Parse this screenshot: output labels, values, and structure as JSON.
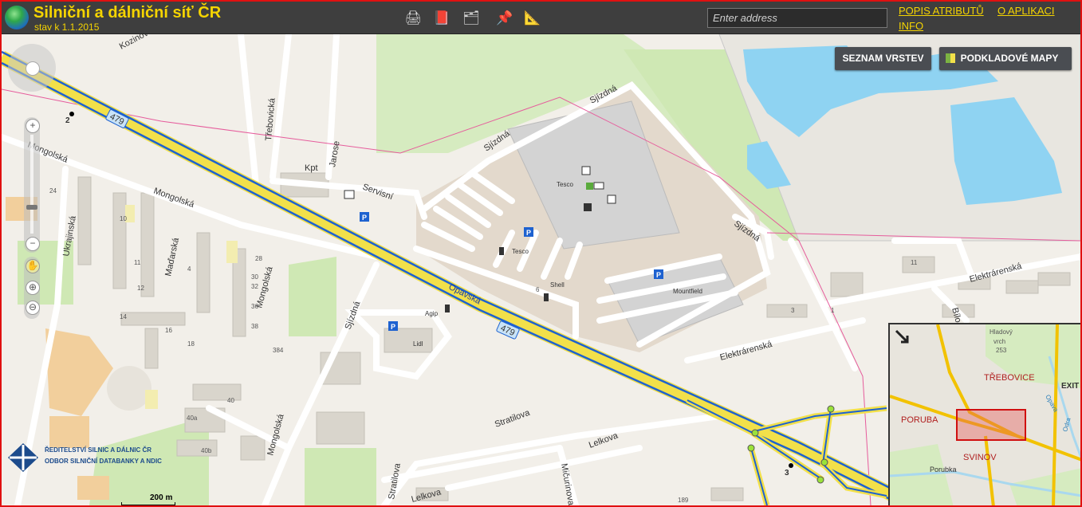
{
  "header": {
    "title": "Silniční a dálniční síť ČR",
    "subtitle": "stav k 1.1.2015",
    "tools": [
      {
        "name": "print-icon",
        "glyph": "🖨"
      },
      {
        "name": "book-icon",
        "glyph": "📕"
      },
      {
        "name": "layers-icon",
        "glyph": "🗂"
      },
      {
        "name": "pin-icon",
        "glyph": "📌"
      },
      {
        "name": "measure-icon",
        "glyph": "📐"
      }
    ],
    "search_placeholder": "Enter address",
    "links": {
      "attributes": "POPIS ATRIBUTŮ",
      "about": "O APLIKACI",
      "info": "INFO"
    }
  },
  "buttons": {
    "layers": "SEZNAM VRSTEV",
    "basemaps": "PODKLADOVÉ MAPY"
  },
  "map": {
    "road_labels": {
      "kozinova": "Kozinova",
      "trebovicka": "Třebovická",
      "jarose": "Jarose",
      "kpt": "Kpt",
      "servisni": "Servisní",
      "sjizdna1": "Sjízdná",
      "sjizdna2": "Sjízdná",
      "sjizdna3": "Sjízdná",
      "sjizdna4": "Sjízdná",
      "mongolska1": "Mongolská",
      "mongolska2": "Mongolská",
      "mongolska3": "Mongolská",
      "mongolska4": "Mongolská",
      "ukrajinska": "Ukrajinská",
      "madarska": "Maďarská",
      "opavska": "Opavská",
      "elektrarenska1": "Elektrárenská",
      "elektrarenska2": "Elektrárenská",
      "stratilova1": "Stratilova",
      "stratilova2": "Stratilova",
      "lelkova1": "Lelkova",
      "lelkova2": "Lelkova",
      "micurinova": "Mičurinova",
      "bilovecka": "Bílo"
    },
    "route_shields": [
      "479",
      "479"
    ],
    "poi_labels": {
      "tesco1": "Tesco",
      "tesco2": "Tesco",
      "shell": "Shell",
      "mountfield": "Mountfield",
      "agip": "Agip",
      "lidl": "Lidl"
    },
    "km_markers": [
      "2",
      "3"
    ],
    "house_numbers": [
      "10",
      "12",
      "16",
      "18",
      "24",
      "28",
      "30",
      "32",
      "36",
      "38",
      "40",
      "14",
      "4",
      "11",
      "384",
      "40a",
      "40b",
      "6",
      "3",
      "1",
      "11",
      "189"
    ]
  },
  "overview": {
    "labels": {
      "trebovice": "TŘEBOVICE",
      "poruba": "PORUBA",
      "porubka": "Porubka",
      "svinov": "SVINOV",
      "exit": "EXIT",
      "hladovy": "Hladový",
      "vrch": "vrch",
      "elev": "253",
      "opava": "Opava",
      "odra": "Odra"
    }
  },
  "scale": {
    "label": "200 m"
  },
  "logo": {
    "line1": "ŘEDITELSTVÍ SILNIC A DÁLNIC ČR",
    "line2": "ODBOR SILNIČNÍ DATABANKY A NDIC"
  },
  "colors": {
    "header_bg": "#3e3e3e",
    "title_yellow": "#f5d400",
    "road_blue": "#1e62d0",
    "road_yellow": "#f2e04a",
    "water": "#8fd3f2",
    "green": "#cfe8b4",
    "frame_red": "#e01010"
  }
}
